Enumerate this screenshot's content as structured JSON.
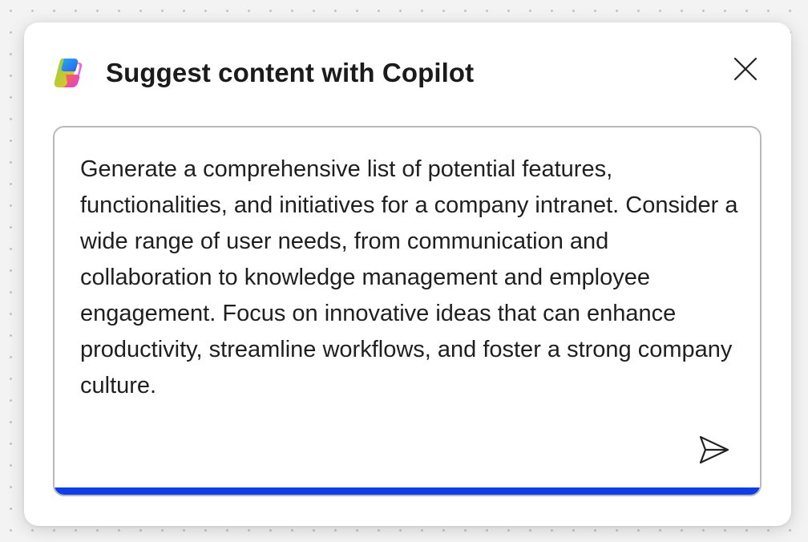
{
  "dialog": {
    "title": "Suggest content with Copilot",
    "logo_icon": "copilot-logo-icon",
    "close_icon": "close-icon"
  },
  "prompt": {
    "text": "Generate a comprehensive list of potential features, functionalities, and initiatives for a company intranet. Consider a wide range of user needs, from communication and collaboration to knowledge management and employee engagement. Focus on innovative ideas that can enhance productivity, streamline workflows, and foster a strong company culture.",
    "send_icon": "send-icon"
  },
  "colors": {
    "focus_accent": "#0f3ee8",
    "border": "#b9b9b9",
    "text": "#1f1f1f",
    "background": "#f3f3f3"
  }
}
